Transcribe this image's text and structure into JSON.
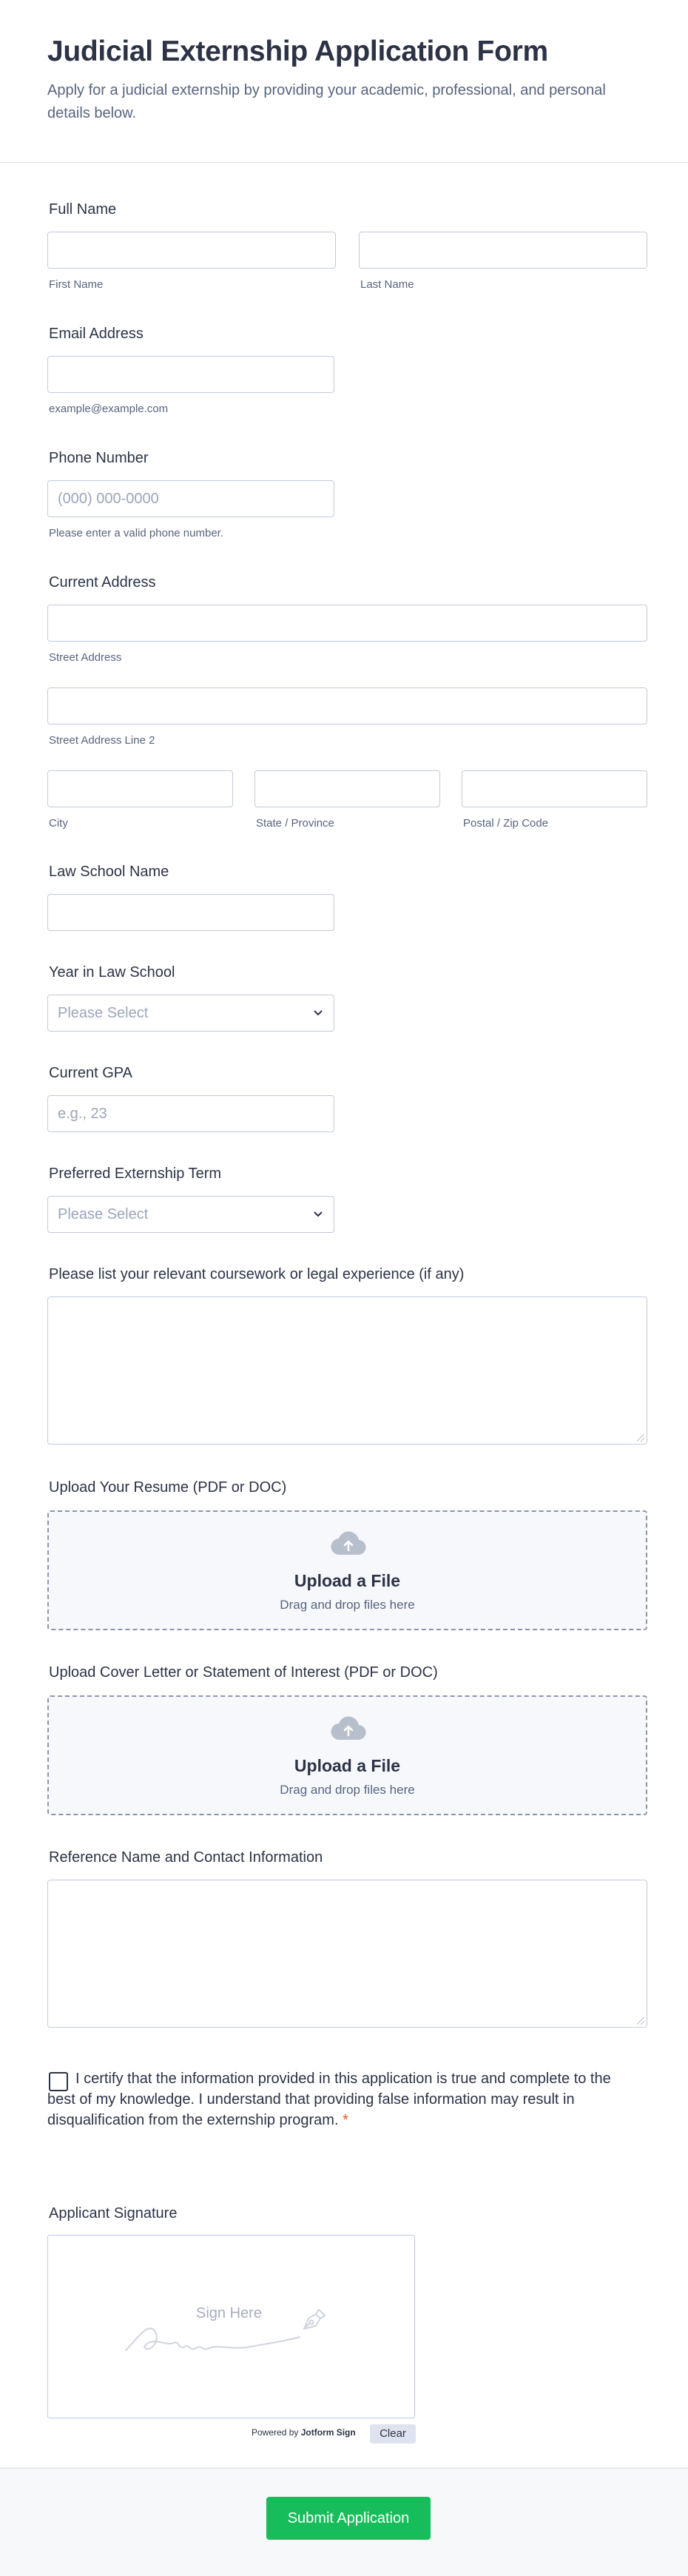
{
  "header": {
    "title": "Judicial Externship Application Form",
    "subtitle": "Apply for a judicial externship by providing your academic, professional, and personal details below."
  },
  "full_name": {
    "label": "Full Name",
    "first_sub": "First Name",
    "last_sub": "Last Name"
  },
  "email": {
    "label": "Email Address",
    "sub": "example@example.com"
  },
  "phone": {
    "label": "Phone Number",
    "placeholder": "(000) 000-0000",
    "sub": "Please enter a valid phone number."
  },
  "address": {
    "label": "Current Address",
    "street_sub": "Street Address",
    "street2_sub": "Street Address Line 2",
    "city_sub": "City",
    "state_sub": "State / Province",
    "zip_sub": "Postal / Zip Code"
  },
  "law_school": {
    "label": "Law School Name"
  },
  "year": {
    "label": "Year in Law School",
    "placeholder": "Please Select"
  },
  "gpa": {
    "label": "Current GPA",
    "placeholder": "e.g., 23"
  },
  "term": {
    "label": "Preferred Externship Term",
    "placeholder": "Please Select"
  },
  "coursework": {
    "label": "Please list your relevant coursework or legal experience (if any)"
  },
  "resume": {
    "label": "Upload Your Resume (PDF or DOC)",
    "button": "Upload a File",
    "hint": "Drag and drop files here"
  },
  "cover": {
    "label": "Upload Cover Letter or Statement of Interest (PDF or DOC)",
    "button": "Upload a File",
    "hint": "Drag and drop files here"
  },
  "reference": {
    "label": "Reference Name and Contact Information"
  },
  "certify": {
    "text": "I certify that the information provided in this application is true and complete to the best of my knowledge. I understand that providing false information may result in disqualification from the externship program.",
    "required_mark": "*"
  },
  "signature": {
    "label": "Applicant Signature",
    "placeholder": "Sign Here",
    "powered_prefix": "Powered by",
    "powered_brand": "Jotform Sign",
    "clear": "Clear"
  },
  "submit": {
    "label": "Submit Application"
  },
  "colors": {
    "accent_green": "#18bd5b",
    "text_dark": "#2c3345",
    "text_muted": "#57647e",
    "border": "#c3cad8"
  },
  "icons": {
    "upload": "cloud-upload-icon",
    "dropdown": "chevron-down-icon",
    "signature": "pen-nib-icon"
  }
}
